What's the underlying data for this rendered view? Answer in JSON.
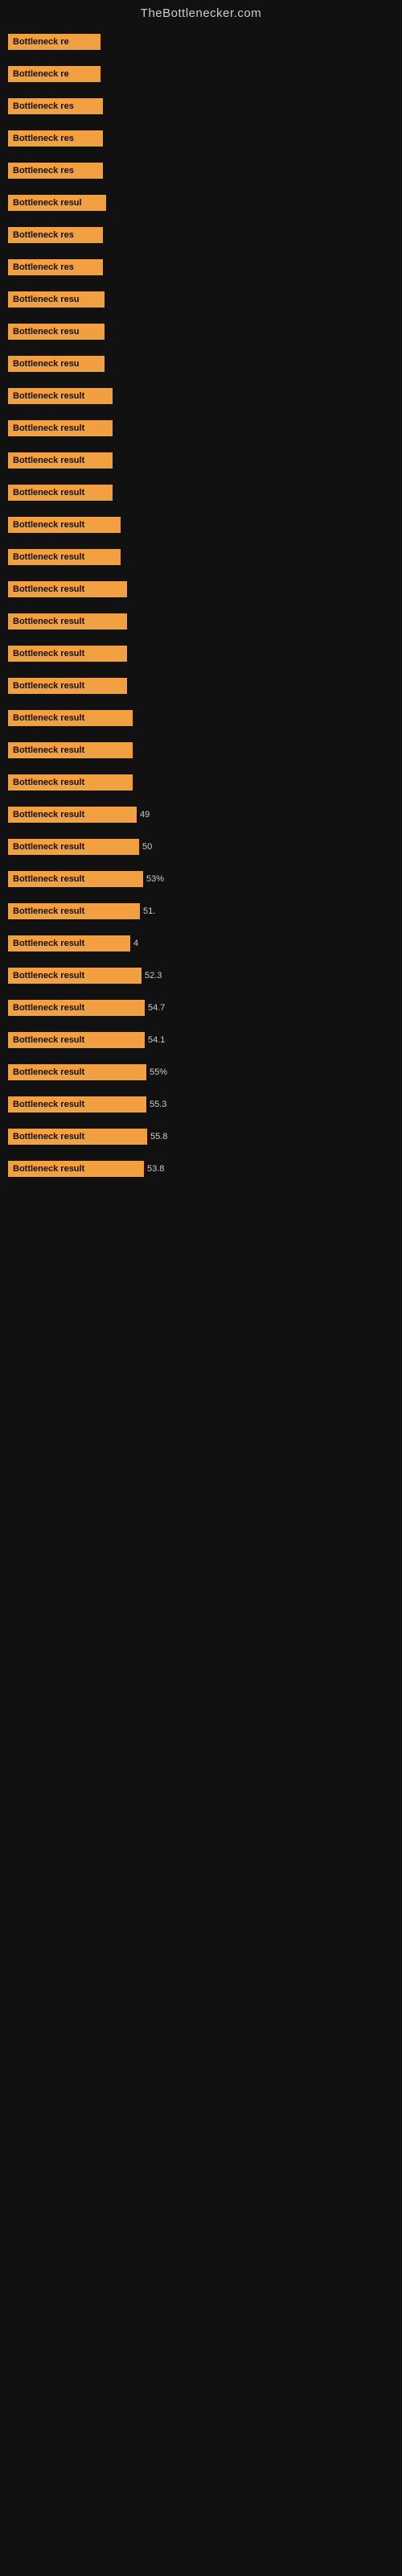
{
  "site": {
    "title": "TheBottlenecker.com"
  },
  "bars": [
    {
      "label": "Bottleneck re",
      "value": "",
      "width": 115
    },
    {
      "label": "Bottleneck re",
      "value": "",
      "width": 115
    },
    {
      "label": "Bottleneck res",
      "value": "",
      "width": 118
    },
    {
      "label": "Bottleneck res",
      "value": "",
      "width": 118
    },
    {
      "label": "Bottleneck res",
      "value": "",
      "width": 118
    },
    {
      "label": "Bottleneck resul",
      "value": "",
      "width": 122
    },
    {
      "label": "Bottleneck res",
      "value": "",
      "width": 118
    },
    {
      "label": "Bottleneck res",
      "value": "",
      "width": 118
    },
    {
      "label": "Bottleneck resu",
      "value": "",
      "width": 120
    },
    {
      "label": "Bottleneck resu",
      "value": "",
      "width": 120
    },
    {
      "label": "Bottleneck resu",
      "value": "",
      "width": 120
    },
    {
      "label": "Bottleneck result",
      "value": "",
      "width": 130
    },
    {
      "label": "Bottleneck result",
      "value": "",
      "width": 130
    },
    {
      "label": "Bottleneck result",
      "value": "",
      "width": 130
    },
    {
      "label": "Bottleneck result",
      "value": "",
      "width": 130
    },
    {
      "label": "Bottleneck result",
      "value": "",
      "width": 140
    },
    {
      "label": "Bottleneck result",
      "value": "",
      "width": 140
    },
    {
      "label": "Bottleneck result",
      "value": "",
      "width": 148
    },
    {
      "label": "Bottleneck result",
      "value": "",
      "width": 148
    },
    {
      "label": "Bottleneck result",
      "value": "",
      "width": 148
    },
    {
      "label": "Bottleneck result",
      "value": "",
      "width": 148
    },
    {
      "label": "Bottleneck result",
      "value": "",
      "width": 155
    },
    {
      "label": "Bottleneck result",
      "value": "",
      "width": 155
    },
    {
      "label": "Bottleneck result",
      "value": "",
      "width": 155
    },
    {
      "label": "Bottleneck result",
      "value": "49",
      "width": 160
    },
    {
      "label": "Bottleneck result",
      "value": "50",
      "width": 163
    },
    {
      "label": "Bottleneck result",
      "value": "53%",
      "width": 168
    },
    {
      "label": "Bottleneck result",
      "value": "51.",
      "width": 164
    },
    {
      "label": "Bottleneck result",
      "value": "4",
      "width": 152
    },
    {
      "label": "Bottleneck result",
      "value": "52.3",
      "width": 166
    },
    {
      "label": "Bottleneck result",
      "value": "54.7",
      "width": 170
    },
    {
      "label": "Bottleneck result",
      "value": "54.1",
      "width": 170
    },
    {
      "label": "Bottleneck result",
      "value": "55%",
      "width": 172
    },
    {
      "label": "Bottleneck result",
      "value": "55.3",
      "width": 172
    },
    {
      "label": "Bottleneck result",
      "value": "55.8",
      "width": 173
    },
    {
      "label": "Bottleneck result",
      "value": "53.8",
      "width": 169
    }
  ]
}
